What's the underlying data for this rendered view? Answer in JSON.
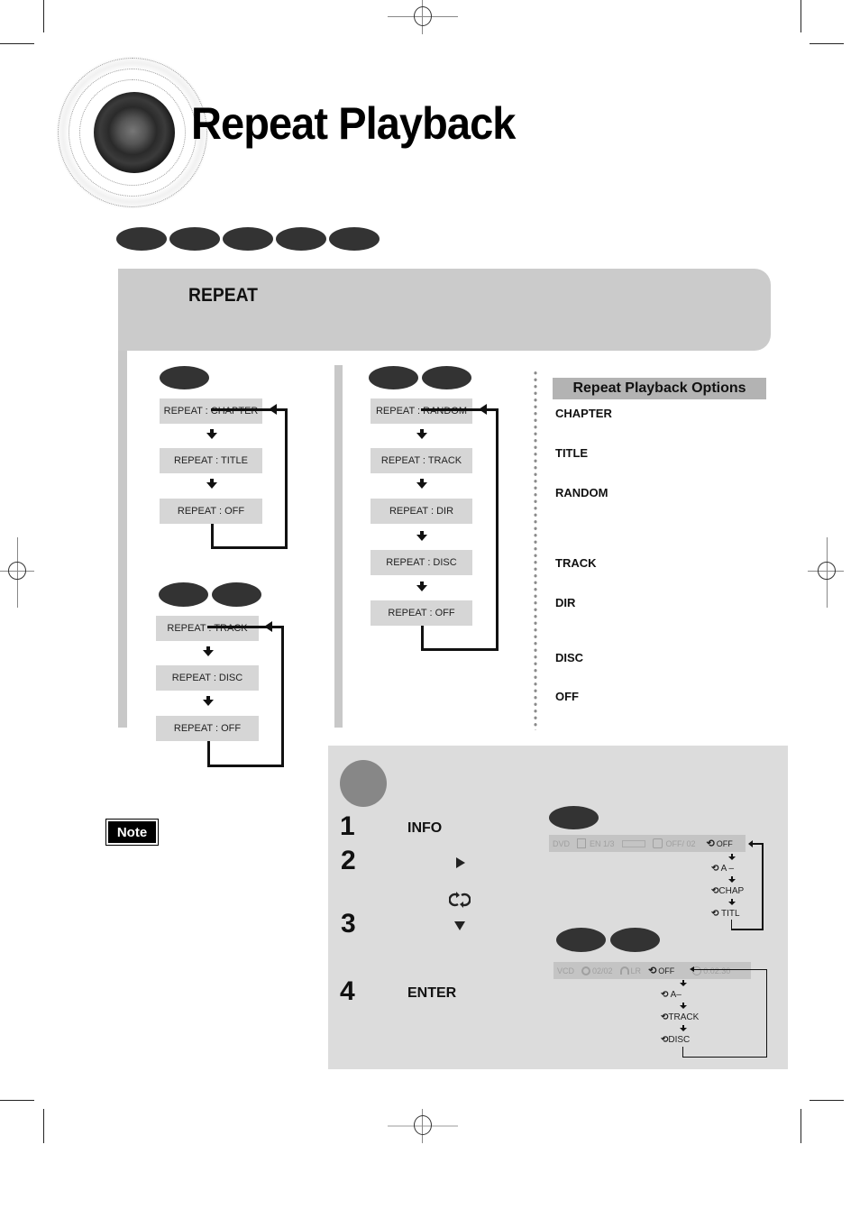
{
  "page": {
    "title": "Repeat Playback"
  },
  "header_badges": [
    "",
    "",
    "",
    "",
    ""
  ],
  "banner": {
    "title": "REPEAT"
  },
  "flows": {
    "dvd": {
      "badges": [
        ""
      ],
      "items": [
        "REPEAT : CHAPTER",
        "REPEAT : TITLE",
        "REPEAT : OFF"
      ]
    },
    "vcd_cd": {
      "badges": [
        "",
        ""
      ],
      "items": [
        "REPEAT : TRACK",
        "REPEAT : DISC",
        "REPEAT : OFF"
      ]
    },
    "mp3_jpeg": {
      "badges": [
        "",
        ""
      ],
      "items": [
        "REPEAT : RANDOM",
        "REPEAT : TRACK",
        "REPEAT : DIR",
        "REPEAT : DISC",
        "REPEAT : OFF"
      ]
    }
  },
  "options": {
    "header": "Repeat Playback Options",
    "items": [
      "CHAPTER",
      "TITLE",
      "RANDOM",
      "TRACK",
      "DIR",
      "DISC",
      "OFF"
    ]
  },
  "note": {
    "label": "Note"
  },
  "steps": [
    {
      "number": "1",
      "label": "INFO"
    },
    {
      "number": "2",
      "label": "",
      "icons": [
        "right-triangle-icon",
        "repeat-icon"
      ]
    },
    {
      "number": "3",
      "label": "",
      "icons": [
        "down-triangle-icon"
      ]
    },
    {
      "number": "4",
      "label": "ENTER"
    }
  ],
  "osd": {
    "dvd": {
      "bar": [
        "DVD",
        "EN 1/3",
        "OFF/ 02",
        "OFF"
      ],
      "cycle": [
        "A –",
        "CHAP",
        "TITL"
      ]
    },
    "vcd": {
      "bar": [
        "VCD",
        "02/02",
        "LR",
        "OFF",
        "0:02:30"
      ],
      "cycle": [
        "A–",
        "TRACK",
        "DISC"
      ]
    }
  },
  "colors": {
    "badge": "#333333",
    "banner": "#cbcbcb",
    "flow_box": "#d6d6d6",
    "panel": "#dcdcdc",
    "options_header": "#b3b3b3"
  }
}
